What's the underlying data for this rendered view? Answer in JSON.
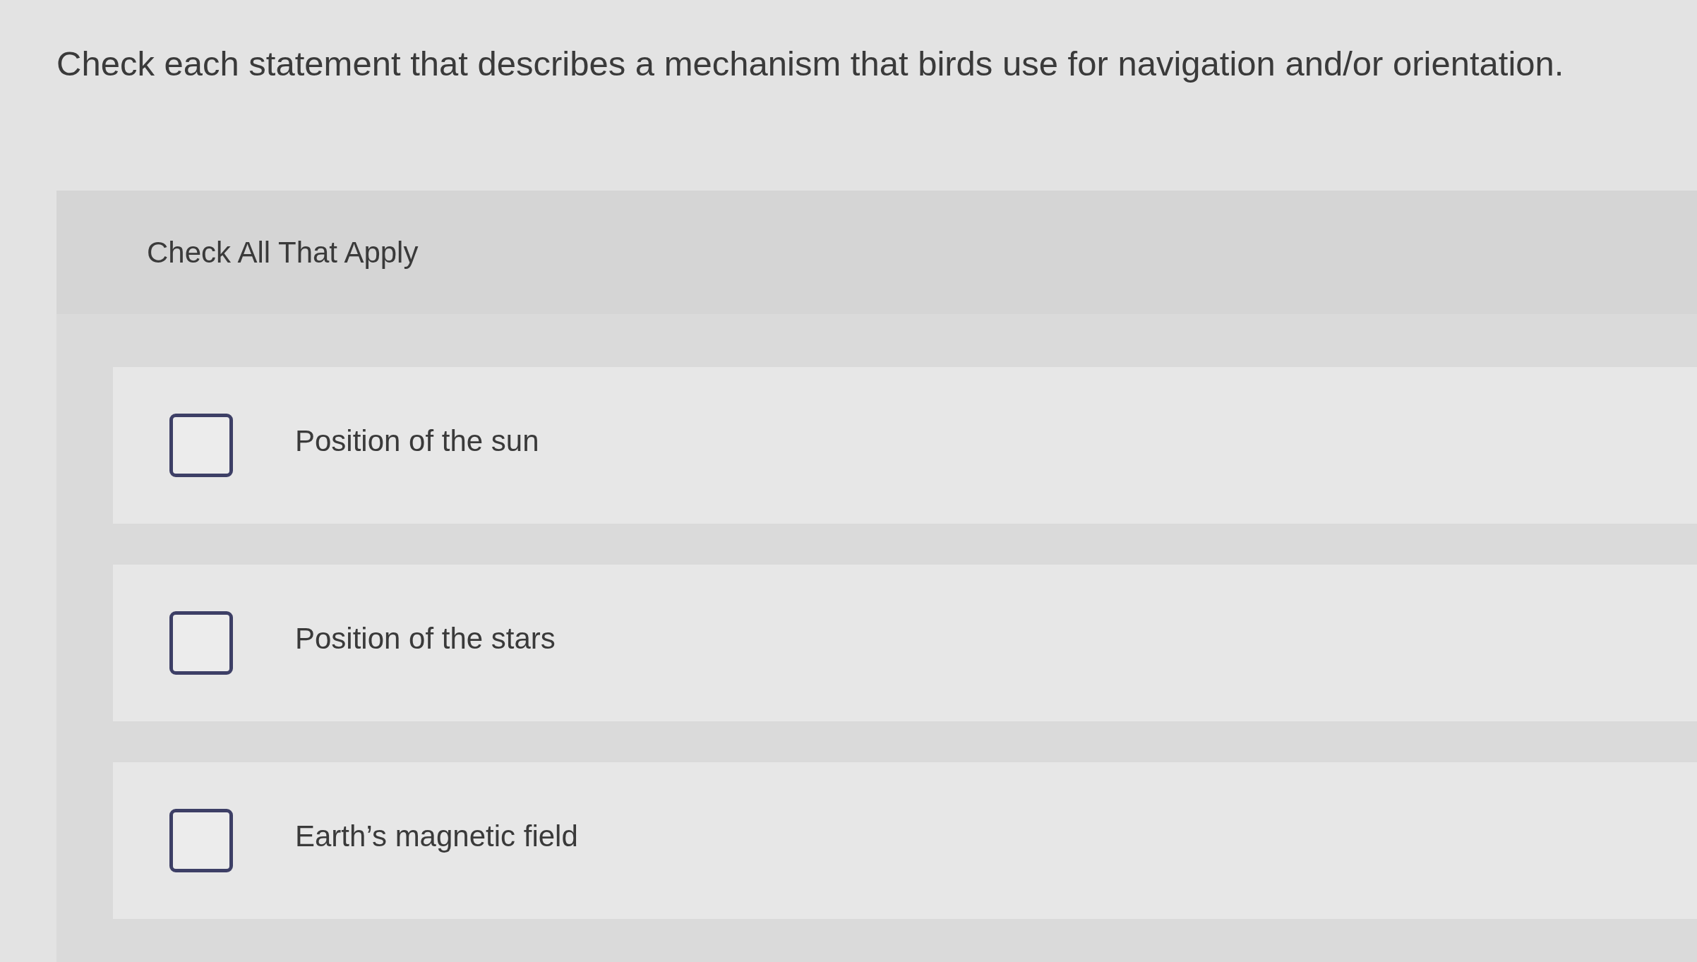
{
  "question": "Check each statement that describes a mechanism that birds use for navigation and/or orientation.",
  "instruction": "Check All That Apply",
  "options": [
    {
      "label": "Position of the sun",
      "checked": false
    },
    {
      "label": "Position of the stars",
      "checked": false
    },
    {
      "label": "Earth’s magnetic field",
      "checked": false
    }
  ]
}
